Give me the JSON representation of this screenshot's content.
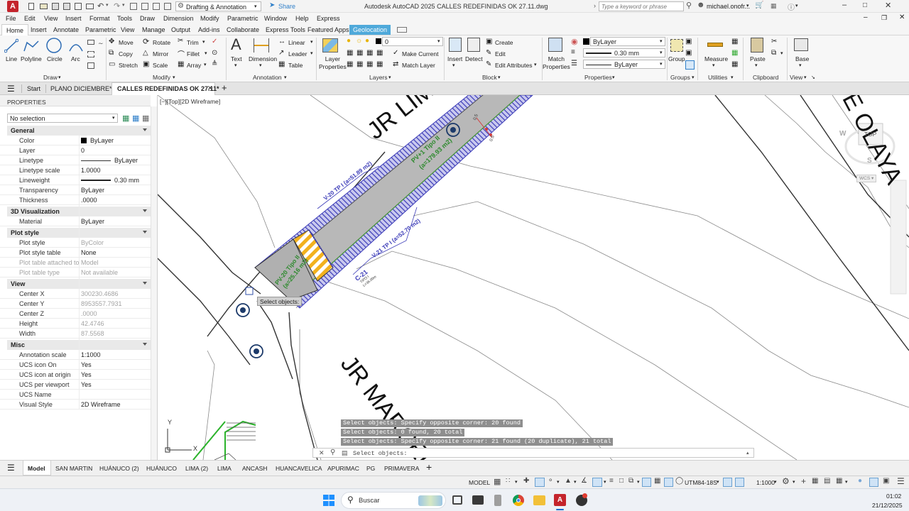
{
  "titlebar": {
    "app_icon": "A",
    "workspace": "Drafting & Annotation",
    "share": "Share",
    "title": "Autodesk AutoCAD 2025    CALLES REDEFINIDAS OK 27.11.dwg",
    "search_placeholder": "Type a keyword or phrase",
    "user": "michael.onofr..."
  },
  "menu": [
    "File",
    "Edit",
    "View",
    "Insert",
    "Format",
    "Tools",
    "Draw",
    "Dimension",
    "Modify",
    "Parametric",
    "Window",
    "Help",
    "Express"
  ],
  "ribbon_tabs": [
    "Home",
    "Insert",
    "Annotate",
    "Parametric",
    "View",
    "Manage",
    "Output",
    "Add-ins",
    "Collaborate",
    "Express Tools",
    "Featured Apps",
    "Geolocation"
  ],
  "ribbon": {
    "draw": {
      "line": "Line",
      "polyline": "Polyline",
      "circle": "Circle",
      "arc": "Arc",
      "panel": "Draw"
    },
    "modify": {
      "move": "Move",
      "rotate": "Rotate",
      "trim": "Trim",
      "copy": "Copy",
      "mirror": "Mirror",
      "fillet": "Fillet",
      "stretch": "Stretch",
      "scale": "Scale",
      "array": "Array",
      "panel": "Modify"
    },
    "annotation": {
      "text": "Text",
      "dimension": "Dimension",
      "linear": "Linear",
      "leader": "Leader",
      "table": "Table",
      "panel": "Annotation"
    },
    "layers": {
      "layer_properties": "Layer\nProperties",
      "current_layer": "0",
      "make_current": "Make Current",
      "match_layer": "Match Layer",
      "panel": "Layers"
    },
    "block": {
      "insert": "Insert",
      "detect": "Detect",
      "create": "Create",
      "edit": "Edit",
      "edit_attributes": "Edit Attributes",
      "panel": "Block"
    },
    "properties": {
      "match": "Match\nProperties",
      "color": "ByLayer",
      "lineweight": "0.30 mm",
      "linetype": "ByLayer",
      "panel": "Properties"
    },
    "groups": {
      "group": "Group",
      "panel": "Groups"
    },
    "utilities": {
      "measure": "Measure",
      "panel": "Utilities"
    },
    "clipboard": {
      "paste": "Paste",
      "panel": "Clipboard"
    },
    "view": {
      "base": "Base",
      "panel": "View"
    }
  },
  "doc_tabs": [
    "Start",
    "PLANO DICIEMBRE*",
    "CALLES REDEFINIDAS OK 27.11*"
  ],
  "properties": {
    "title": "PROPERTIES",
    "selection": "No selection",
    "sections": {
      "general": "General",
      "vis3d": "3D Visualization",
      "plot": "Plot style",
      "view": "View",
      "misc": "Misc"
    },
    "general": [
      {
        "k": "Color",
        "v": "ByLayer"
      },
      {
        "k": "Layer",
        "v": "0"
      },
      {
        "k": "Linetype",
        "v": "ByLayer"
      },
      {
        "k": "Linetype scale",
        "v": "1.0000"
      },
      {
        "k": "Lineweight",
        "v": "0.30 mm"
      },
      {
        "k": "Transparency",
        "v": "ByLayer"
      },
      {
        "k": "Thickness",
        "v": ".0000"
      }
    ],
    "vis3d": [
      {
        "k": "Material",
        "v": "ByLayer"
      }
    ],
    "plot": [
      {
        "k": "Plot style",
        "v": "ByColor"
      },
      {
        "k": "Plot style table",
        "v": "None"
      },
      {
        "k": "Plot table attached to",
        "v": "Model"
      },
      {
        "k": "Plot table type",
        "v": "Not available"
      }
    ],
    "view": [
      {
        "k": "Center X",
        "v": "300230.4686"
      },
      {
        "k": "Center Y",
        "v": "8953557.7931"
      },
      {
        "k": "Center Z",
        "v": ".0000"
      },
      {
        "k": "Height",
        "v": "42.4746"
      },
      {
        "k": "Width",
        "v": "87.5568"
      }
    ],
    "misc": [
      {
        "k": "Annotation scale",
        "v": "1:1000"
      },
      {
        "k": "UCS icon On",
        "v": "Yes"
      },
      {
        "k": "UCS icon at origin",
        "v": "Yes"
      },
      {
        "k": "UCS per viewport",
        "v": "Yes"
      },
      {
        "k": "UCS Name",
        "v": ""
      },
      {
        "k": "Visual Style",
        "v": "2D Wireframe"
      }
    ]
  },
  "canvas": {
    "viewport_label": "[−][Top][2D Wireframe]",
    "street1": "JR LIMA",
    "street2": "JR MARCELINO",
    "street3": "E OLAYA",
    "pv1": "PV+1 Tipo II",
    "pv1_area": "(a=179.93 m2)",
    "pv20": "PV-20 Tipo II",
    "pv20_area": "(a=25.16 m2)",
    "v20": "V-20  TP I (a=51.89 m2)",
    "v21": "V-21  TP I (a=52.70 m2)",
    "c21": "C-21",
    "c21_sub": "TIPO I",
    "c21_sub2": "L=36.00m",
    "dim_label": "0.5",
    "tooltip": "Select objects:",
    "viewcube_top": "TOP",
    "viewcube_w": "W",
    "viewcube_s": "S",
    "wcs": "WCS",
    "ucs_y": "Y",
    "ucs_x": "X"
  },
  "command": {
    "history": [
      "Select objects: Specify opposite corner: 20 found",
      "Select objects: 0 found, 20 total",
      "Select objects: Specify opposite corner: 21 found (20 duplicate), 21 total"
    ],
    "prompt": "Select objects:"
  },
  "layout_tabs": [
    "Model",
    "SAN MARTIN",
    "HUÁNUCO (2)",
    "HUÁNUCO",
    "LIMA (2)",
    "LIMA",
    "ANCASH",
    "HUANCAVELICA",
    "APURIMAC",
    "PG",
    "PRIMAVERA"
  ],
  "status": {
    "model": "MODEL",
    "coord": "UTM84-18S",
    "scale": "1:1000"
  },
  "taskbar": {
    "search": "Buscar",
    "time": "01:02",
    "date": "21/12/2025"
  }
}
